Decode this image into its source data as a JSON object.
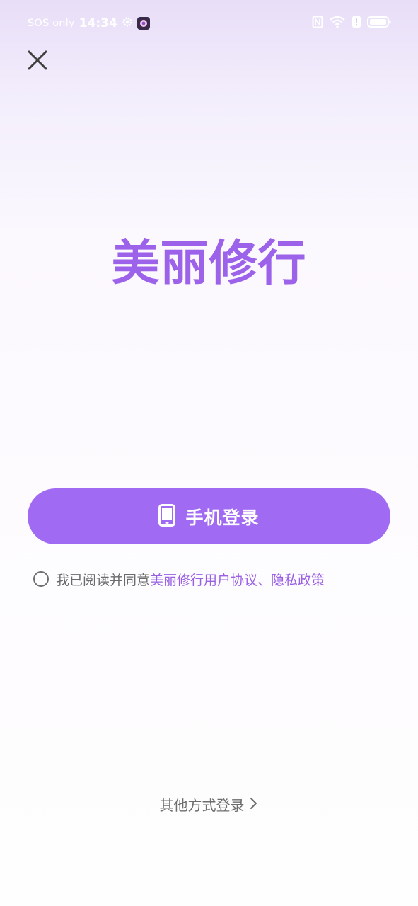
{
  "status_bar": {
    "carrier": "SOS only",
    "time": "14:34",
    "icons": [
      "gear-icon",
      "app-notification-icon",
      "nfc-icon",
      "wifi-icon",
      "alert-icon",
      "battery-icon"
    ]
  },
  "header": {
    "close_icon": "close-icon"
  },
  "brand": {
    "title": "美丽修行"
  },
  "login": {
    "phone_button_label": "手机登录",
    "phone_icon": "mobile-phone-icon"
  },
  "agreement": {
    "prefix": "我已阅读并同意",
    "terms_link": "美丽修行用户协议",
    "separator": "、",
    "privacy_link": "隐私政策"
  },
  "footer": {
    "other_login_label": "其他方式登录",
    "chevron_icon": "chevron-right-icon"
  },
  "colors": {
    "accent": "#a06af2",
    "brand_text": "#9d62ea",
    "link": "#9a5fe4",
    "bg_top": "#e8def8",
    "bg_bottom": "#fefefe"
  }
}
